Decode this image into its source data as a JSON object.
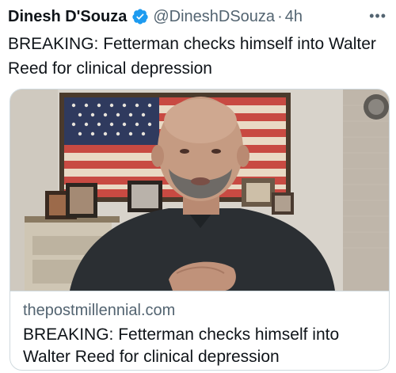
{
  "tweet": {
    "display_name": "Dinesh D'Souza",
    "handle": "@DineshDSouza",
    "separator": "·",
    "time": "4h",
    "more_icon": "more-horizontal-icon",
    "text": "BREAKING: Fetterman checks himself into Walter Reed for clinical depression"
  },
  "card": {
    "domain": "thepostmillennial.com",
    "title": "BREAKING: Fetterman checks himself into Walter Reed for clinical depression"
  },
  "colors": {
    "verified_badge": "#1d9bf0",
    "secondary_text": "#536471",
    "card_border": "#cfd9de"
  }
}
